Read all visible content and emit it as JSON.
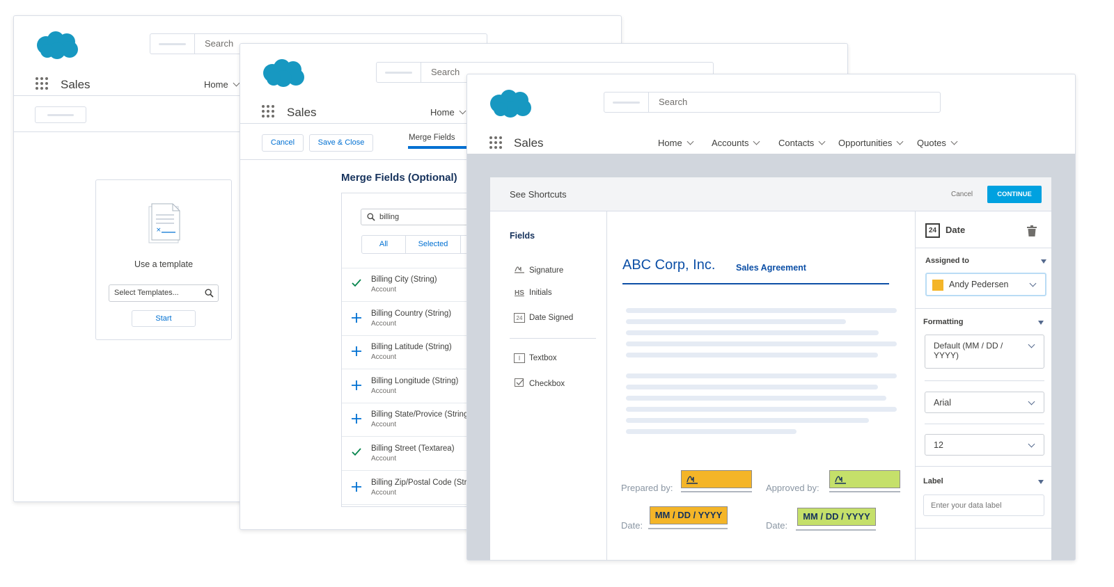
{
  "app": {
    "name": "Sales",
    "search_placeholder": "Search"
  },
  "window1": {
    "nav_home": "Home",
    "template_card": {
      "label": "Use a template",
      "select_placeholder": "Select Templates...",
      "start": "Start"
    }
  },
  "window2": {
    "nav_home": "Home",
    "toolbar": {
      "cancel": "Cancel",
      "save_close": "Save & Close",
      "tab_merge_fields": "Merge Fields"
    },
    "section_title": "Merge Fields (Optional)",
    "filter_value": "billing",
    "filter_tabs": [
      "All",
      "Selected"
    ],
    "fields": [
      {
        "name": "Billing City (String)",
        "object": "Account",
        "selected": true
      },
      {
        "name": "Billing Country (String)",
        "object": "Account",
        "selected": false
      },
      {
        "name": "Billing Latitude (String)",
        "object": "Account",
        "selected": false
      },
      {
        "name": "Billing Longitude (String)",
        "object": "Account",
        "selected": false
      },
      {
        "name": "Billing State/Provice (String",
        "object": "Account",
        "selected": false
      },
      {
        "name": "Billing Street (Textarea)",
        "object": "Account",
        "selected": true
      },
      {
        "name": "Billing Zip/Postal Code (Stri",
        "object": "Account",
        "selected": false
      }
    ]
  },
  "window3": {
    "nav": [
      {
        "label": "Home"
      },
      {
        "label": "Accounts"
      },
      {
        "label": "Contacts"
      },
      {
        "label": "Opportunities"
      },
      {
        "label": "Quotes"
      }
    ],
    "editor": {
      "title": "See Shortcuts",
      "cancel": "Cancel",
      "continue": "CONTINUE",
      "fields_heading": "Fields",
      "field_types_group1": [
        {
          "label": "Signature",
          "icon": "signature-icon"
        },
        {
          "label": "Initials",
          "icon": "initials-icon",
          "glyph": "HS"
        },
        {
          "label": "Date Signed",
          "icon": "calendar-icon",
          "glyph": "24"
        }
      ],
      "field_types_group2": [
        {
          "label": "Textbox",
          "icon": "textbox-icon",
          "glyph": "I"
        },
        {
          "label": "Checkbox",
          "icon": "checkbox-icon"
        }
      ],
      "document": {
        "company": "ABC Corp, Inc.",
        "doc_type": "Sales Agreement",
        "prepared_by": "Prepared by:",
        "approved_by": "Approved by:",
        "date_label_1": "Date:",
        "date_label_2": "Date:",
        "date_placeholder_1": "MM / DD / YYYY",
        "date_placeholder_2": "MM / DD / YYYY",
        "colors": {
          "prepared": "#f4b528",
          "approved": "#c5e06a"
        }
      },
      "properties": {
        "field_title": "Date",
        "field_glyph": "24",
        "assigned_to_label": "Assigned to",
        "assigned_to_value": "Andy Pedersen",
        "assignee_color": "#f4b528",
        "formatting_label": "Formatting",
        "format_value": "Default (MM / DD / YYYY)",
        "font_value": "Arial",
        "size_value": "12",
        "label_label": "Label",
        "label_placeholder": "Enter your data label"
      }
    }
  },
  "colors": {
    "brand_blue": "#1798c1",
    "accent": "#00a1e0",
    "link": "#0070d2",
    "title_blue": "#0c4fa6"
  }
}
